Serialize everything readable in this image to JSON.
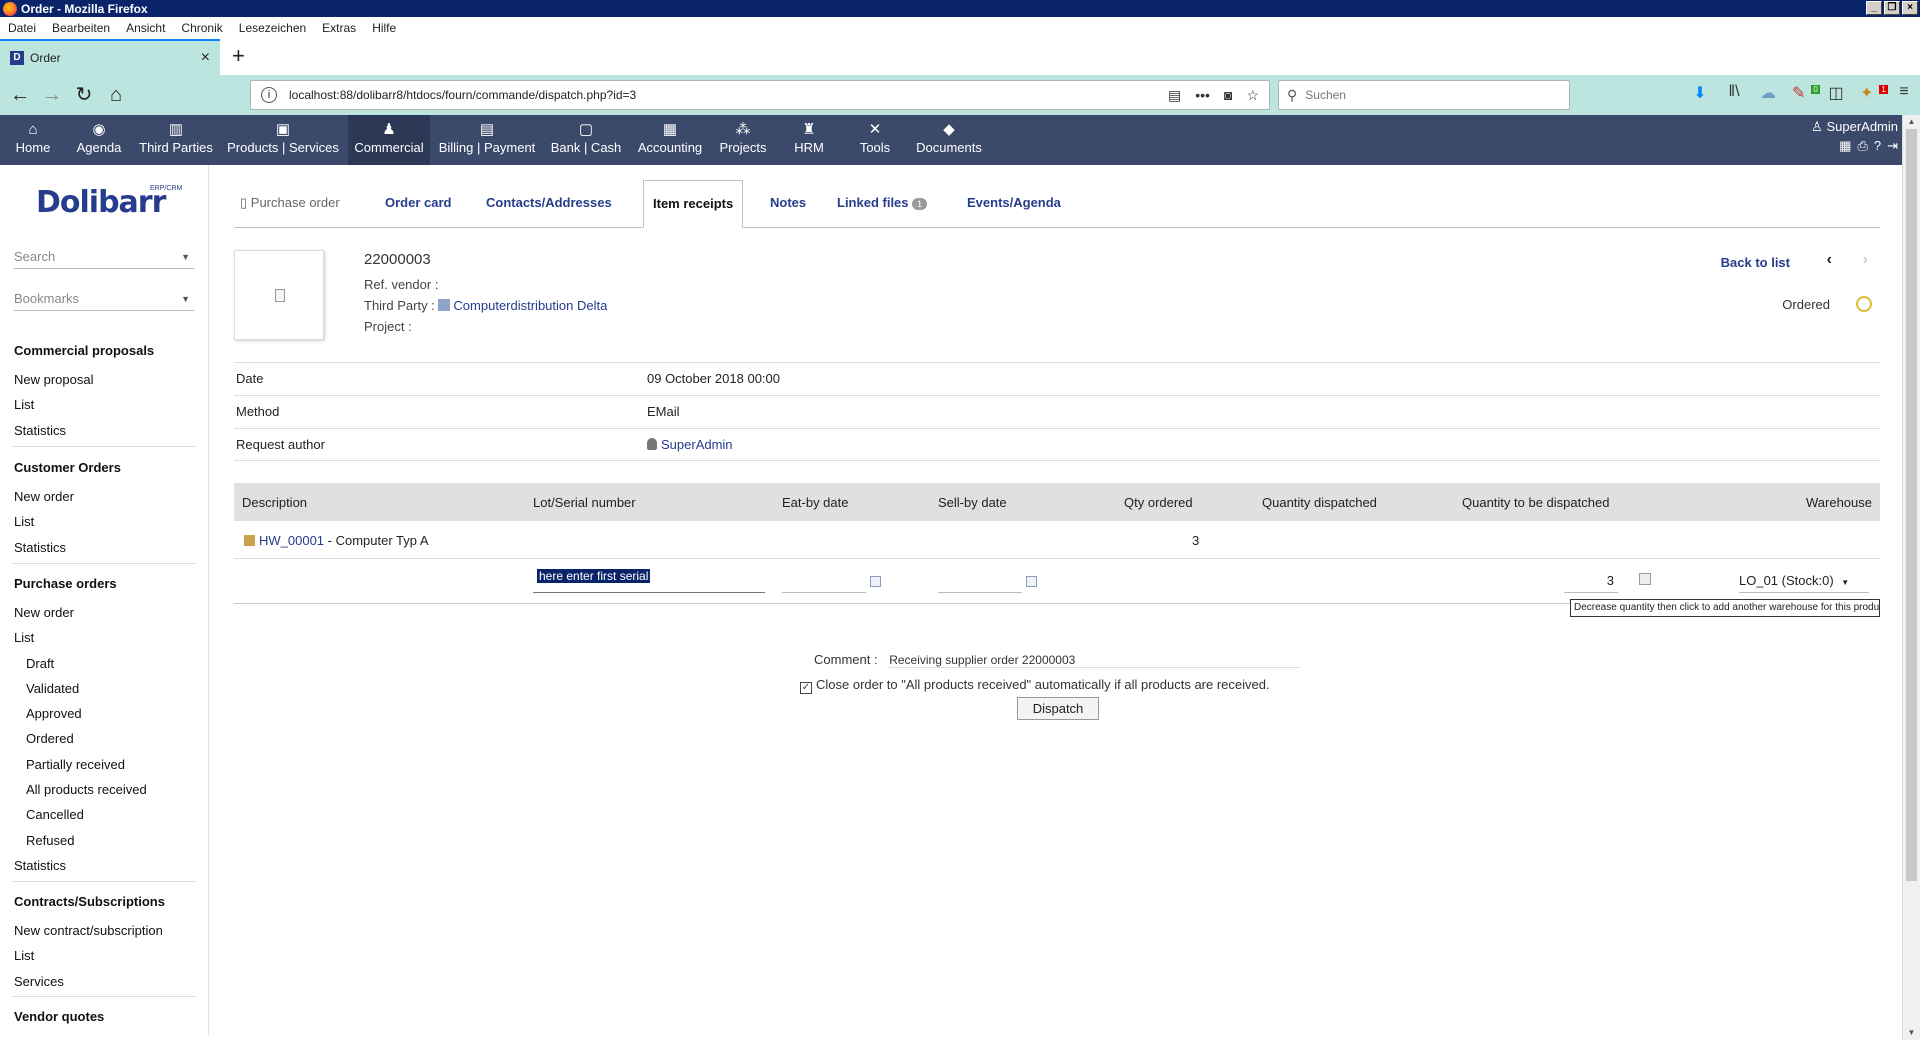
{
  "window": {
    "title": "Order - Mozilla Firefox"
  },
  "menubar": [
    "Datei",
    "Bearbeiten",
    "Ansicht",
    "Chronik",
    "Lesezeichen",
    "Extras",
    "Hilfe"
  ],
  "browser_tab": {
    "title": "Order"
  },
  "address": {
    "url": "localhost:88/dolibarr8/htdocs/fourn/commande/dispatch.php?id=3",
    "search_placeholder": "Suchen"
  },
  "topmenu": {
    "items": [
      "Home",
      "Agenda",
      "Third Parties",
      "Products | Services",
      "Commercial",
      "Billing | Payment",
      "Bank | Cash",
      "Accounting",
      "Projects",
      "HRM",
      "Tools",
      "Documents"
    ],
    "user": "SuperAdmin"
  },
  "leftmenu": {
    "logo": "Dolibarr",
    "logo_sub": "ERP/CRM",
    "search_placeholder": "Search",
    "bookmarks_placeholder": "Bookmarks",
    "commercial_proposals": {
      "title": "Commercial proposals",
      "items": [
        "New proposal",
        "List",
        "Statistics"
      ]
    },
    "customer_orders": {
      "title": "Customer Orders",
      "items": [
        "New order",
        "List",
        "Statistics"
      ]
    },
    "purchase_orders": {
      "title": "Purchase orders",
      "items": [
        "New order",
        "List"
      ],
      "sub": [
        "Draft",
        "Validated",
        "Approved",
        "Ordered",
        "Partially received",
        "All products received",
        "Cancelled",
        "Refused"
      ],
      "stats": "Statistics"
    },
    "contracts": {
      "title": "Contracts/Subscriptions",
      "items": [
        "New contract/subscription",
        "List",
        "Services"
      ]
    },
    "vendor_quotes": {
      "title": "Vendor quotes"
    }
  },
  "tabs": {
    "purchase_order": "Purchase order",
    "order_card": "Order card",
    "contacts": "Contacts/Addresses",
    "item_receipts": "Item receipts",
    "notes": "Notes",
    "linked_files": "Linked files",
    "linked_files_count": "1",
    "events": "Events/Agenda"
  },
  "order": {
    "ref": "22000003",
    "ref_vendor_label": "Ref. vendor :",
    "third_party_label": "Third Party :",
    "third_party": "Computerdistribution Delta",
    "project_label": "Project :",
    "back_to_list": "Back to list",
    "status": "Ordered",
    "status_color": "#d8bc33"
  },
  "fields": {
    "date_label": "Date",
    "date_value": "09 October 2018 00:00",
    "method_label": "Method",
    "method_value": "EMail",
    "author_label": "Request author",
    "author_value": "SuperAdmin"
  },
  "table": {
    "headers": {
      "description": "Description",
      "lot": "Lot/Serial number",
      "eatby": "Eat-by date",
      "sellby": "Sell-by date",
      "qty_ordered": "Qty ordered",
      "qty_dispatched": "Quantity dispatched",
      "qty_to_dispatch": "Quantity to be dispatched",
      "warehouse": "Warehouse"
    },
    "row": {
      "product_ref": "HW_00001",
      "product_label": " - Computer Typ A",
      "qty_ordered": "3"
    },
    "input_row": {
      "serial_value": "here enter first serial",
      "qty": "3",
      "warehouse": "LO_01 (Stock:0)"
    },
    "tooltip": "Decrease quantity then click to add another warehouse for this product"
  },
  "footer": {
    "comment_label": "Comment :",
    "comment_value": "Receiving supplier order 22000003",
    "close_option": "Close order to \"All products received\" automatically if all products are received.",
    "close_checked": true,
    "dispatch_button": "Dispatch"
  }
}
